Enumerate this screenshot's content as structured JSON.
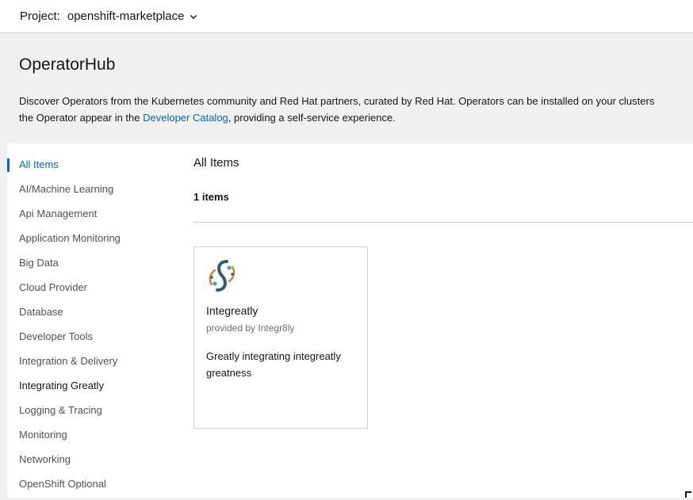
{
  "project_bar": {
    "label": "Project:",
    "value": "openshift-marketplace",
    "chevron_icon": "chevron-down-icon"
  },
  "page": {
    "title": "OperatorHub",
    "description_part1": "Discover Operators from the Kubernetes community and Red Hat partners, curated by Red Hat. Operators can be installed on your clusters",
    "description_part2": "the Operator appear in the ",
    "description_link": "Developer Catalog",
    "description_part3": ", providing a self-service experience."
  },
  "sidebar": {
    "items": [
      {
        "label": "All Items",
        "state": "active"
      },
      {
        "label": "AI/Machine Learning"
      },
      {
        "label": "Api Management"
      },
      {
        "label": "Application Monitoring"
      },
      {
        "label": "Big Data"
      },
      {
        "label": "Cloud Provider"
      },
      {
        "label": "Database"
      },
      {
        "label": "Developer Tools"
      },
      {
        "label": "Integration & Delivery"
      },
      {
        "label": "Integrating Greatly",
        "state": "bold"
      },
      {
        "label": "Logging & Tracing"
      },
      {
        "label": "Monitoring"
      },
      {
        "label": "Networking"
      },
      {
        "label": "OpenShift Optional"
      }
    ]
  },
  "main": {
    "title": "All Items",
    "count": "1 items",
    "tiles": [
      {
        "name": "Integreatly",
        "provider": "provided by Integr8ly",
        "summary": "Greatly integrating integreatly greatness",
        "logo_icon": "integreatly-logo-icon"
      }
    ]
  },
  "colors": {
    "link": "#0066cc",
    "background": "#f0f0f0",
    "panel": "#ffffff",
    "border": "#d2d2d2"
  }
}
